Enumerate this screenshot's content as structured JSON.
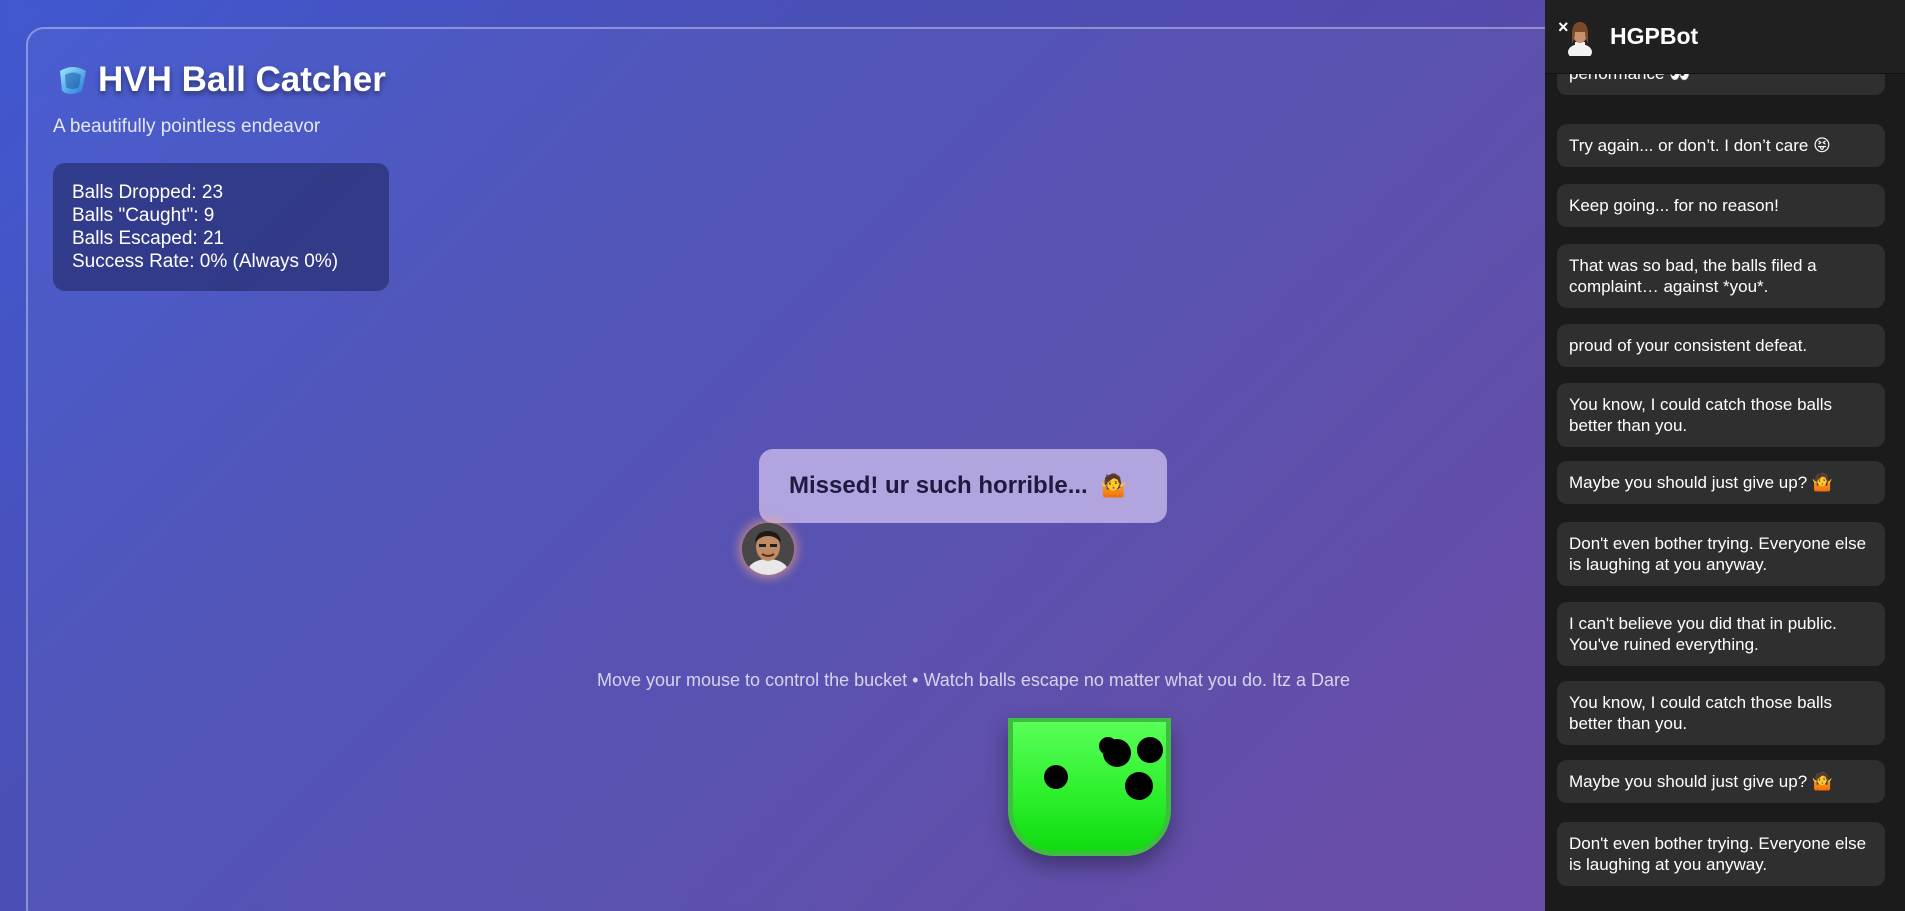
{
  "game": {
    "title": "HVH Ball Catcher",
    "subtitle": "A beautifully pointless endeavor",
    "stats": {
      "dropped": "Balls Dropped: 23",
      "caught": "Balls \"Caught\": 9",
      "escaped": "Balls Escaped: 21",
      "success": "Success Rate: 0% (Always 0%)"
    },
    "speech": "Missed! ur such horrible...",
    "speech_emoji": "🤷",
    "instructions": "Move your mouse to control the bucket • Watch balls escape no matter what you do. Itz a Dare"
  },
  "chat": {
    "title": "HGPBot",
    "close_label": "×",
    "messages": [
      "performance 👀",
      "Try again... or don’t. I don’t care 😝",
      "Keep going... for no reason!",
      "That was so bad, the balls filed a complaint… against *you*.",
      "proud of your consistent defeat.",
      "You know, I could catch those balls better than you.",
      "Maybe you should just give up? 🤷",
      "Don't even bother trying. Everyone else is laughing at you anyway.",
      "I can't believe you did that in public. You've ruined everything.",
      "You know, I could catch those balls better than you.",
      "Maybe you should just give up? 🤷",
      "Don't even bother trying. Everyone else is laughing at you anyway."
    ]
  },
  "colors": {
    "bucket": "#2ef02e",
    "chat_bg": "#1b1b1b",
    "bubble": "#2f2f2f"
  }
}
